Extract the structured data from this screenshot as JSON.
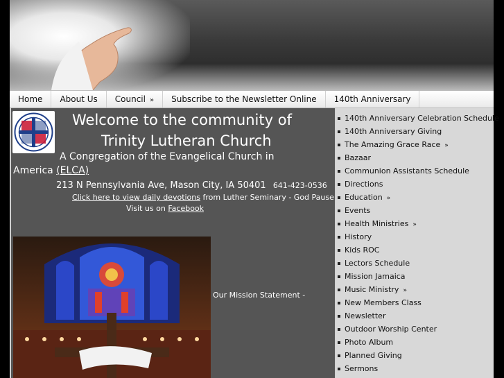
{
  "nav": {
    "items": [
      {
        "label": "Home",
        "has_submenu": false
      },
      {
        "label": "About Us",
        "has_submenu": false
      },
      {
        "label": "Council",
        "has_submenu": true
      },
      {
        "label": "Subscribe to the Newsletter Online",
        "has_submenu": false
      },
      {
        "label": "140th Anniversary",
        "has_submenu": false
      }
    ],
    "submenu_glyph": "»"
  },
  "content": {
    "welcome_line1": "Welcome to the community of",
    "welcome_line2": "Trinity Lutheran Church",
    "congregation_line1": "A Congregation of the Evangelical Church in",
    "congregation_line2": "America",
    "elca_link": "(ELCA)",
    "address": "213 N Pennsylvania Ave, Mason City, IA 50401",
    "phone": "641-423-0536",
    "devotions_link": "Click here to view daily devotions",
    "devotions_suffix": " from Luther Seminary - God Pause",
    "facebook_prefix": "Visit us on ",
    "facebook_link": "Facebook",
    "mission_label": "Our Mission Statement -",
    "logo_ring_text": "EVANGELICAL LUTHERAN CHURCH IN AMERICA"
  },
  "sidebar": {
    "items": [
      {
        "label": "140th Anniversary Celebration Schedule",
        "arrow": ""
      },
      {
        "label": "140th Anniversary Giving",
        "arrow": ""
      },
      {
        "label": "The Amazing Grace Race",
        "arrow": "»"
      },
      {
        "label": "Bazaar",
        "arrow": ""
      },
      {
        "label": "Communion Assistants Schedule",
        "arrow": ""
      },
      {
        "label": "Directions",
        "arrow": ""
      },
      {
        "label": "Education",
        "arrow": "»"
      },
      {
        "label": "Events",
        "arrow": ""
      },
      {
        "label": "Health Ministries",
        "arrow": "»"
      },
      {
        "label": "History",
        "arrow": ""
      },
      {
        "label": "Kids ROC",
        "arrow": ""
      },
      {
        "label": "Lectors Schedule",
        "arrow": ""
      },
      {
        "label": "Mission Jamaica",
        "arrow": ""
      },
      {
        "label": "Music Ministry",
        "arrow": "»"
      },
      {
        "label": "New Members Class",
        "arrow": ""
      },
      {
        "label": "Newsletter",
        "arrow": ""
      },
      {
        "label": "Outdoor Worship Center",
        "arrow": ""
      },
      {
        "label": "Photo Album",
        "arrow": ""
      },
      {
        "label": "Planned Giving",
        "arrow": ""
      },
      {
        "label": "Sermons",
        "arrow": ""
      }
    ]
  },
  "colors": {
    "content_bg": "#555555",
    "sidebar_bg": "#d8d8d8",
    "nav_bg": "#ffffff",
    "logo_red": "#c8102e",
    "logo_blue": "#1f3f8a"
  }
}
